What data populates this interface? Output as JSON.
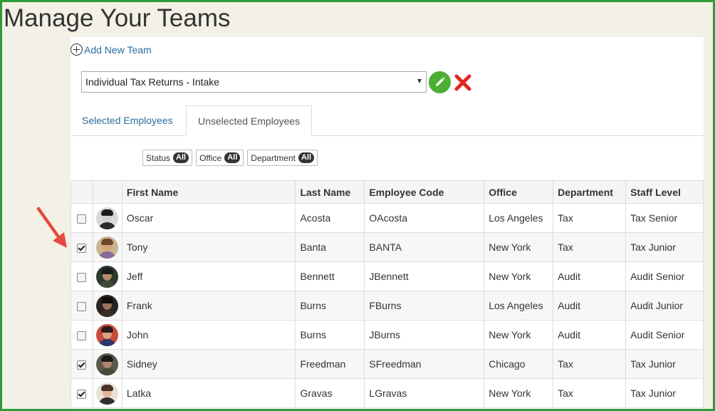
{
  "page": {
    "title": "Manage Your Teams"
  },
  "add_team": {
    "label": "Add New Team"
  },
  "team_select": {
    "value": "Individual Tax Returns - Intake"
  },
  "tabs": [
    {
      "label": "Selected Employees",
      "active": false
    },
    {
      "label": "Unselected Employees",
      "active": true
    }
  ],
  "filters": [
    {
      "label": "Status",
      "value": "All"
    },
    {
      "label": "Office",
      "value": "All"
    },
    {
      "label": "Department",
      "value": "All"
    }
  ],
  "table": {
    "headers": [
      "First Name",
      "Last Name",
      "Employee Code",
      "Office",
      "Department",
      "Staff Level"
    ],
    "rows": [
      {
        "checked": false,
        "avatar_icon": "avatar-icon",
        "first": "Oscar",
        "last": "Acosta",
        "code": "OAcosta",
        "office": "Los Angeles",
        "department": "Tax",
        "level": "Tax Senior"
      },
      {
        "checked": true,
        "avatar_icon": "avatar-icon",
        "first": "Tony",
        "last": "Banta",
        "code": "BANTA",
        "office": "New York",
        "department": "Tax",
        "level": "Tax Junior"
      },
      {
        "checked": false,
        "avatar_icon": "avatar-icon",
        "first": "Jeff",
        "last": "Bennett",
        "code": "JBennett",
        "office": "New York",
        "department": "Audit",
        "level": "Audit Senior"
      },
      {
        "checked": false,
        "avatar_icon": "avatar-icon",
        "first": "Frank",
        "last": "Burns",
        "code": "FBurns",
        "office": "Los Angeles",
        "department": "Audit",
        "level": "Audit Junior"
      },
      {
        "checked": false,
        "avatar_icon": "avatar-icon",
        "first": "John",
        "last": "Burns",
        "code": "JBurns",
        "office": "New York",
        "department": "Audit",
        "level": "Audit Senior"
      },
      {
        "checked": true,
        "avatar_icon": "avatar-icon",
        "first": "Sidney",
        "last": "Freedman",
        "code": "SFreedman",
        "office": "Chicago",
        "department": "Tax",
        "level": "Tax Junior"
      },
      {
        "checked": true,
        "avatar_icon": "avatar-icon",
        "first": "Latka",
        "last": "Gravas",
        "code": "LGravas",
        "office": "New York",
        "department": "Tax",
        "level": "Tax Junior"
      }
    ]
  },
  "colors": {
    "frame": "#2e9b3a",
    "link": "#2a6e9e",
    "edit_button": "#4caf34",
    "delete_icon": "#e52620",
    "annotation_arrow": "#e8483f"
  }
}
